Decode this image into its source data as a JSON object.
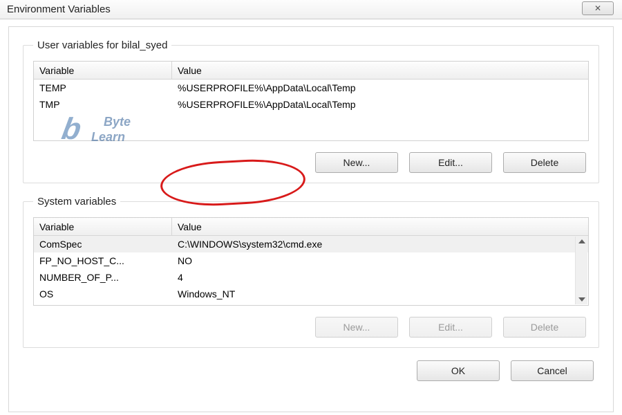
{
  "window": {
    "title": "Environment Variables",
    "close_glyph": "✕"
  },
  "user_group": {
    "legend": "User variables for bilal_syed",
    "columns": {
      "variable": "Variable",
      "value": "Value"
    },
    "rows": [
      {
        "variable": "TEMP",
        "value": "%USERPROFILE%\\AppData\\Local\\Temp"
      },
      {
        "variable": "TMP",
        "value": "%USERPROFILE%\\AppData\\Local\\Temp"
      }
    ],
    "buttons": {
      "new": "New...",
      "edit": "Edit...",
      "delete": "Delete"
    }
  },
  "system_group": {
    "legend": "System variables",
    "columns": {
      "variable": "Variable",
      "value": "Value"
    },
    "rows": [
      {
        "variable": "ComSpec",
        "value": "C:\\WINDOWS\\system32\\cmd.exe"
      },
      {
        "variable": "FP_NO_HOST_C...",
        "value": "NO"
      },
      {
        "variable": "NUMBER_OF_P...",
        "value": "4"
      },
      {
        "variable": "OS",
        "value": "Windows_NT"
      }
    ],
    "buttons": {
      "new": "New...",
      "edit": "Edit...",
      "delete": "Delete"
    }
  },
  "dialog_buttons": {
    "ok": "OK",
    "cancel": "Cancel"
  },
  "watermark": {
    "byte": "Byte",
    "learn": "Learn"
  }
}
